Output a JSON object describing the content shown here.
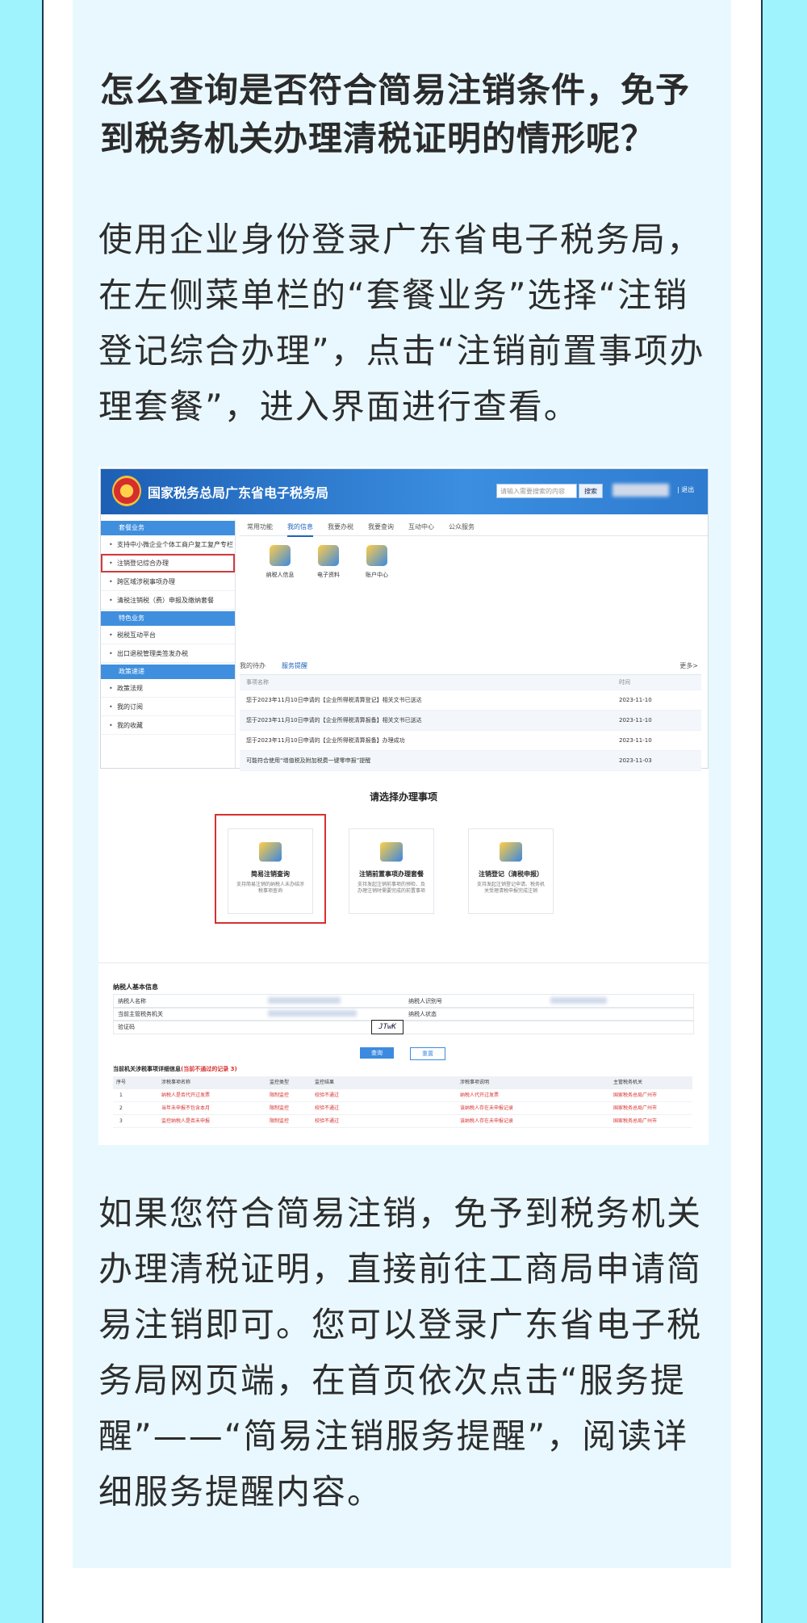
{
  "question": {
    "title": "怎么查询是否符合简易注销条件，免予到税务机关办理清税证明的情形呢？"
  },
  "intro": "使用企业身份登录广东省电子税务局，在左侧菜单栏的“套餐业务”选择“注销登记综合办理”，点击“注销前置事项办理套餐”，进入界面进行查看。",
  "outro": "如果您符合简易注销，免予到税务机关办理清税证明，直接前往工商局申请简易注销即可。您可以登录广东省电子税务局网页端，在首页依次点击“服务提醒”——“简易注销服务提醒”，阅读详细服务提醒内容。",
  "screenshot": {
    "site_title": "国家税务总局广东省电子税务局",
    "search_placeholder": "请输入需要搜索的内容",
    "search_btn": "搜索",
    "logout": "| 退出",
    "sidebar": {
      "groups": [
        {
          "head": "套餐业务",
          "items": [
            "支持中小微企业个体工商户复工复产专栏",
            "注销登记综合办理",
            "跨区域涉税事项办理",
            "清税注销税（费）申报及缴纳套餐"
          ]
        },
        {
          "head": "特色业务",
          "items": [
            "税税互动平台",
            "出口退税管理类签发办税"
          ]
        },
        {
          "head": "政策速递",
          "items": [
            "政策法规",
            "我的订阅",
            "我的收藏"
          ]
        }
      ]
    },
    "tabs": [
      "常用功能",
      "我的信息",
      "我要办税",
      "我要查询",
      "互动中心",
      "公众服务"
    ],
    "apps": [
      "纳税人信息",
      "电子资料",
      "账户中心"
    ],
    "tasks": {
      "tab1": "我的待办",
      "tab2": "服务提醒",
      "more": "更多>",
      "col1": "事项名称",
      "col2": "时间",
      "rows": [
        {
          "name": "您于2023年11月10日申请的【企业所得税清算登记】相关文书已送达",
          "date": "2023-11-10"
        },
        {
          "name": "您于2023年11月10日申请的【企业所得税清算报备】相关文书已送达",
          "date": "2023-11-10"
        },
        {
          "name": "您于2023年11月10日申请的【企业所得税清算报备】办理成功",
          "date": "2023-11-10"
        },
        {
          "name": "可能符合使用“增值税及附加税费一键零申报”提醒",
          "date": "2023-11-03"
        }
      ]
    },
    "choose_title": "请选择办理事项",
    "options": [
      {
        "title": "简易注销查询",
        "desc": "支持简易注销的纳税人未办结涉税事项查询"
      },
      {
        "title": "注销前置事项办理套餐",
        "desc": "支持发起注销前事项的预检、及办理注销时需要完成的前置事项"
      },
      {
        "title": "注销登记（清税申报）",
        "desc": "支持发起注销登记申请、税务机关受理清税申报完成注销"
      }
    ],
    "info": {
      "head": "纳税人基本信息",
      "labels": [
        "纳税人名称",
        "纳税人识别号",
        "当前主管税务机关",
        "纳税人状态",
        "验证码"
      ],
      "captcha": "JTwK",
      "query": "查询",
      "reset": "重置"
    },
    "result": {
      "head": "当前机关涉税事项详细信息",
      "count": "(当前不通过的记录 3)",
      "cols": [
        "序号",
        "涉税事项名称",
        "监控类型",
        "监控结果",
        "涉税事项说明",
        "主管税务机关"
      ],
      "rows": [
        [
          "1",
          "纳税人是否代开过发票",
          "限制监控",
          "校验不通过",
          "纳税人代开过发票",
          "国家税务总局广州市"
        ],
        [
          "2",
          "当年未申报不包含本月",
          "限制监控",
          "校验不通过",
          "该纳税人存在未申报记录",
          "国家税务总局广州市"
        ],
        [
          "3",
          "监控纳税人是否未申报",
          "限制监控",
          "校验不通过",
          "该纳税人存在未申报记录",
          "国家税务总局广州市"
        ]
      ]
    }
  }
}
